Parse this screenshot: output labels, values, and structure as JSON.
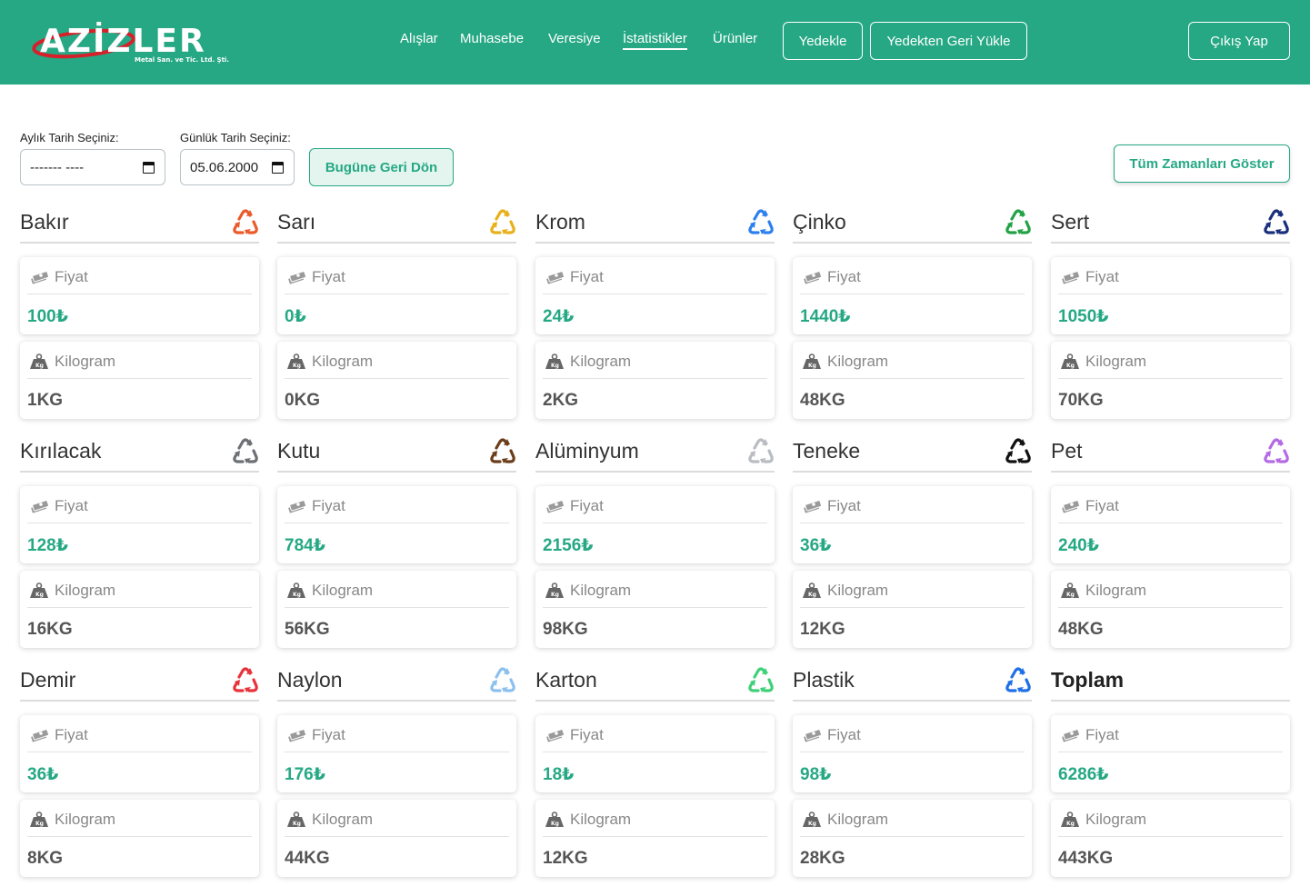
{
  "brand": {
    "logo_text": "AZİZLER",
    "subtitle": "Metal San. ve Tic. Ltd. Şti."
  },
  "nav": {
    "links": [
      "Alışlar",
      "Muhasebe",
      "Veresiye",
      "İstatistikler",
      "Ürünler"
    ],
    "active": "İstatistikler",
    "backup_label": "Yedekle",
    "restore_label": "Yedekten Geri Yükle",
    "logout_label": "Çıkış Yap"
  },
  "filters": {
    "monthly_label": "Aylık Tarih Seçiniz:",
    "monthly_value": "------- ----",
    "daily_label": "Günlük Tarih Seçiniz:",
    "daily_value": "05.06.2000",
    "today_button": "Bugüne Geri Dön",
    "all_time_button": "Tüm Zamanları Göster"
  },
  "labels": {
    "price": "Fiyat",
    "kilogram": "Kilogram"
  },
  "colors": {
    "brand": "#26a884"
  },
  "materials": [
    {
      "name": "Bakır",
      "price": "100₺",
      "kg": "1KG",
      "icon_color": "#ea5a2a"
    },
    {
      "name": "Sarı",
      "price": "0₺",
      "kg": "0KG",
      "icon_color": "#e8b01a"
    },
    {
      "name": "Krom",
      "price": "24₺",
      "kg": "2KG",
      "icon_color": "#2d7ff0"
    },
    {
      "name": "Çinko",
      "price": "1440₺",
      "kg": "48KG",
      "icon_color": "#22a244"
    },
    {
      "name": "Sert",
      "price": "1050₺",
      "kg": "70KG",
      "icon_color": "#1a2f7a"
    },
    {
      "name": "Kırılacak",
      "price": "128₺",
      "kg": "16KG",
      "icon_color": "#6c6f73"
    },
    {
      "name": "Kutu",
      "price": "784₺",
      "kg": "56KG",
      "icon_color": "#6b3d1a"
    },
    {
      "name": "Alüminyum",
      "price": "2156₺",
      "kg": "98KG",
      "icon_color": "#b9bcc0"
    },
    {
      "name": "Teneke",
      "price": "36₺",
      "kg": "12KG",
      "icon_color": "#111111"
    },
    {
      "name": "Pet",
      "price": "240₺",
      "kg": "48KG",
      "icon_color": "#b46ae6"
    },
    {
      "name": "Demir",
      "price": "36₺",
      "kg": "8KG",
      "icon_color": "#e8323a"
    },
    {
      "name": "Naylon",
      "price": "176₺",
      "kg": "44KG",
      "icon_color": "#8cc0ee"
    },
    {
      "name": "Karton",
      "price": "18₺",
      "kg": "12KG",
      "icon_color": "#3fd079"
    },
    {
      "name": "Plastik",
      "price": "98₺",
      "kg": "28KG",
      "icon_color": "#1f6fe6"
    },
    {
      "name": "Toplam",
      "price": "6286₺",
      "kg": "443KG",
      "icon_color": "",
      "total": true
    }
  ]
}
